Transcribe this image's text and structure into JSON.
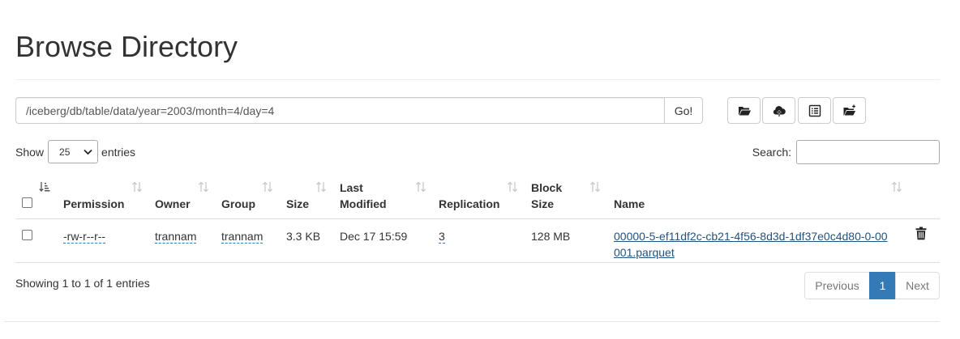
{
  "page": {
    "title": "Browse Directory"
  },
  "path_bar": {
    "value": "/iceberg/db/table/data/year=2003/month=4/day=4",
    "go_label": "Go!"
  },
  "toolbar": {
    "buttons": [
      {
        "icon": "folder-open-icon"
      },
      {
        "icon": "cloud-upload-icon"
      },
      {
        "icon": "list-alt-icon"
      },
      {
        "icon": "folder-new-icon"
      }
    ]
  },
  "length_control": {
    "prefix": "Show",
    "selected": "25",
    "suffix": "entries"
  },
  "search": {
    "label": "Search:",
    "value": ""
  },
  "table": {
    "columns": [
      "Permission",
      "Owner",
      "Group",
      "Size",
      "Last Modified",
      "Replication",
      "Block Size",
      "Name"
    ],
    "rows": [
      {
        "permission": "-rw-r--r--",
        "owner": "trannam",
        "group": "trannam",
        "size": "3.3 KB",
        "last_modified": "Dec 17 15:59",
        "replication": "3",
        "block_size": "128 MB",
        "name": "00000-5-ef11df2c-cb21-4f56-8d3d-1df37e0c4d80-0-00001.parquet"
      }
    ]
  },
  "footer": {
    "info": "Showing 1 to 1 of 1 entries",
    "pagination": {
      "previous": "Previous",
      "current": "1",
      "next": "Next"
    }
  },
  "colors": {
    "accent": "#337ab7",
    "link": "#23527c",
    "text": "#333333"
  }
}
